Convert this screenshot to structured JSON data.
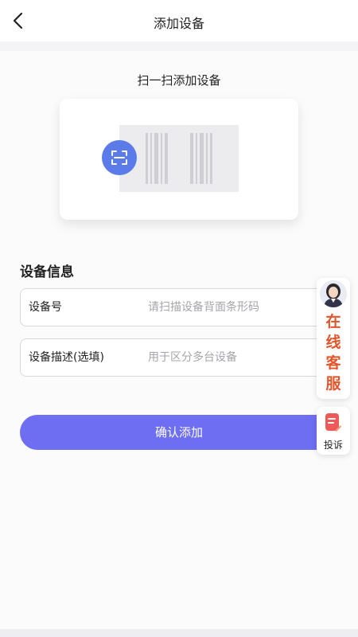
{
  "header": {
    "title": "添加设备",
    "back_icon": "chevron-left-icon"
  },
  "scan": {
    "title": "扫一扫添加设备",
    "icon": "scan-icon",
    "accent_color": "#5a7be8"
  },
  "device_info": {
    "section_title": "设备信息",
    "fields": [
      {
        "label": "设备号",
        "value": "",
        "placeholder": "请扫描设备背面条形码"
      },
      {
        "label": "设备描述(选填)",
        "value": "",
        "placeholder": "用于区分多台设备"
      }
    ]
  },
  "confirm_button": {
    "label": "确认添加",
    "color": "#6d6ef2"
  },
  "customer_service": {
    "text": [
      "在",
      "线",
      "客",
      "服"
    ],
    "color": "#e2542a"
  },
  "complaint": {
    "label": "投诉",
    "icon_color": "#ee5a5a"
  }
}
